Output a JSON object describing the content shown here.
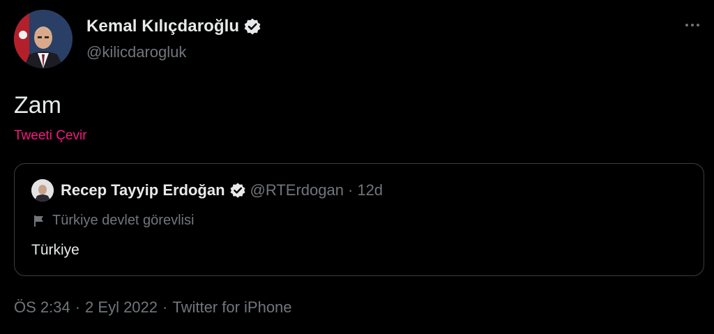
{
  "author": {
    "name": "Kemal Kılıçdaroğlu",
    "handle": "@kilicdarogluk",
    "verified": true
  },
  "tweet": {
    "text": "Zam",
    "translate_label": "Tweeti Çevir"
  },
  "quoted": {
    "name": "Recep Tayyip Erdoğan",
    "handle": "@RTErdogan",
    "separator": "·",
    "time": "12d",
    "label": "Türkiye devlet görevlisi",
    "text": "Türkiye",
    "verified": true
  },
  "meta": {
    "time": "ÖS 2:34",
    "separator": "·",
    "date": "2 Eyl 2022",
    "source": "Twitter for iPhone"
  },
  "colors": {
    "background": "#000000",
    "primary_text": "#e7e9ea",
    "secondary_text": "#71767b",
    "translate_link": "#f91880",
    "border": "#3a3d40"
  },
  "icons": [
    "verified-badge-icon",
    "more-options-icon",
    "government-flag-icon"
  ]
}
